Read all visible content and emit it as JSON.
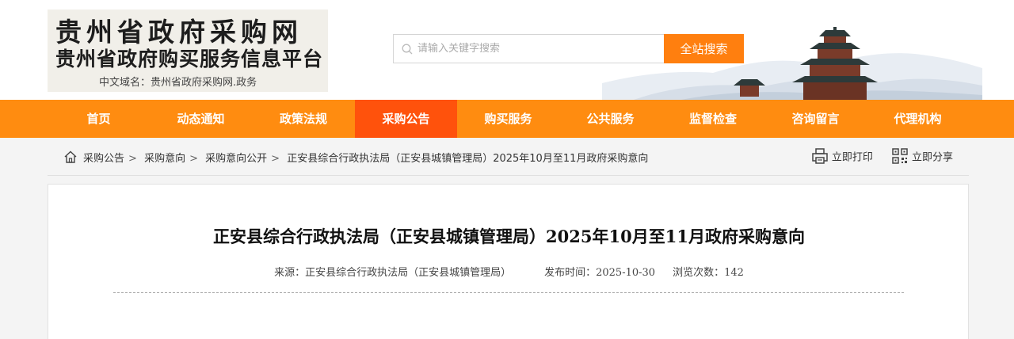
{
  "header": {
    "logo_line1": "贵州省政府采购网",
    "logo_line2": "贵州省政府购买服务信息平台",
    "logo_line3": "中文域名：贵州省政府采购网.政务",
    "search_placeholder": "请输入关键字搜索",
    "search_button": "全站搜索"
  },
  "nav": {
    "items": [
      {
        "label": "首页"
      },
      {
        "label": "动态通知"
      },
      {
        "label": "政策法规"
      },
      {
        "label": "采购公告",
        "active": true
      },
      {
        "label": "购买服务"
      },
      {
        "label": "公共服务"
      },
      {
        "label": "监督检查"
      },
      {
        "label": "咨询留言"
      },
      {
        "label": "代理机构"
      }
    ]
  },
  "breadcrumb": {
    "items": [
      "采购公告",
      "采购意向",
      "采购意向公开"
    ],
    "separator": ">",
    "current": "正安县综合行政执法局（正安县城镇管理局）2025年10月至11月政府采购意向"
  },
  "tools": {
    "print": "立即打印",
    "share": "立即分享"
  },
  "article": {
    "title": "正安县综合行政执法局（正安县城镇管理局）2025年10月至11月政府采购意向",
    "source": "来源：正安县综合行政执法局（正安县城镇管理局）",
    "publish_time": "发布时间：2025-10-30",
    "views": "浏览次数：142"
  },
  "colors": {
    "nav_bg": "#ff8c10",
    "nav_active": "#ff520c",
    "search_button": "#ff7f0f"
  }
}
